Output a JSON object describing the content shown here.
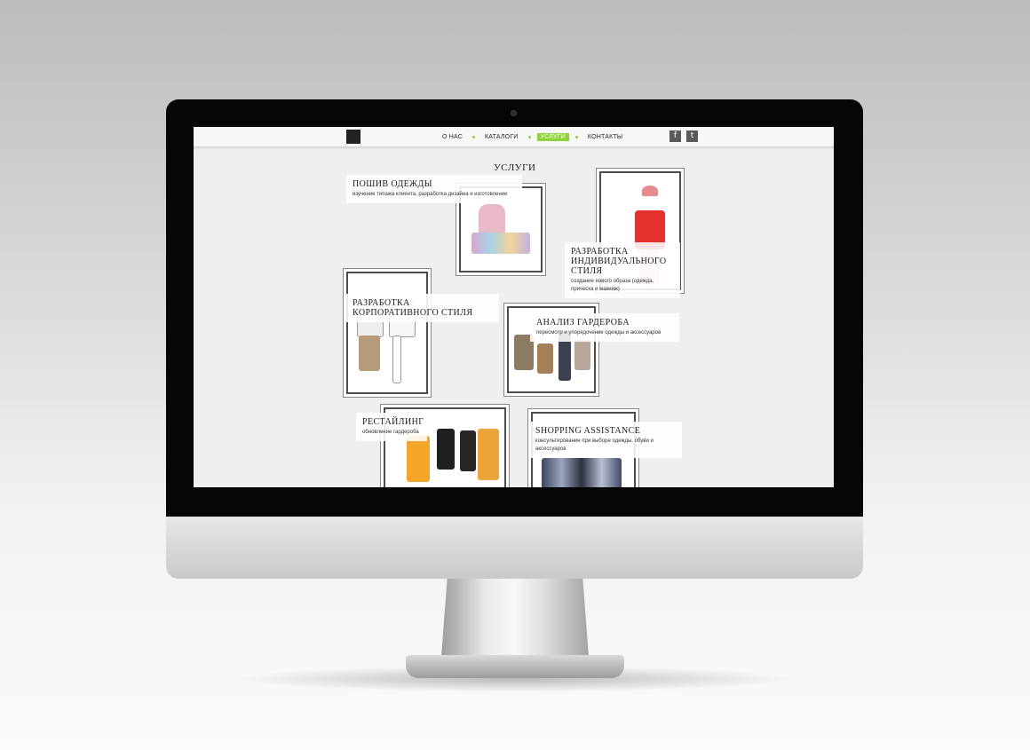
{
  "nav": {
    "items": [
      {
        "label": "О НАС",
        "active": false
      },
      {
        "label": "КАТАЛОГИ",
        "active": false
      },
      {
        "label": "УСЛУГИ",
        "active": true
      },
      {
        "label": "КОНТАКТЫ",
        "active": false
      }
    ],
    "accent_color": "#8fd23a",
    "social": [
      {
        "icon": "facebook-icon",
        "glyph": "f"
      },
      {
        "icon": "twitter-icon",
        "glyph": "t"
      }
    ]
  },
  "page": {
    "title": "УСЛУГИ"
  },
  "services": [
    {
      "title": "ПОШИВ ОДЕЖДЫ",
      "desc": "изучение типажа клиента, разработка дизайна и изготовление"
    },
    {
      "title": "РАЗРАБОТКА ИНДИВИДУАЛЬНОГО СТИЛЯ",
      "desc": "создание нового образа (одежда, прическа и макияж)"
    },
    {
      "title": "РАЗРАБОТКА КОРПОРАТИВНОГО СТИЛЯ",
      "desc": ""
    },
    {
      "title": "АНАЛИЗ ГАРДЕРОБА",
      "desc": "пересмотр и упорядочение одежды и аксессуаров"
    },
    {
      "title": "РЕСТАЙЛИНГ",
      "desc": "обновление гардероба"
    },
    {
      "title": "SHOPPING ASSISTANCE",
      "desc": "консультирование при выборе одежды, обуви и аксессуаров"
    }
  ]
}
